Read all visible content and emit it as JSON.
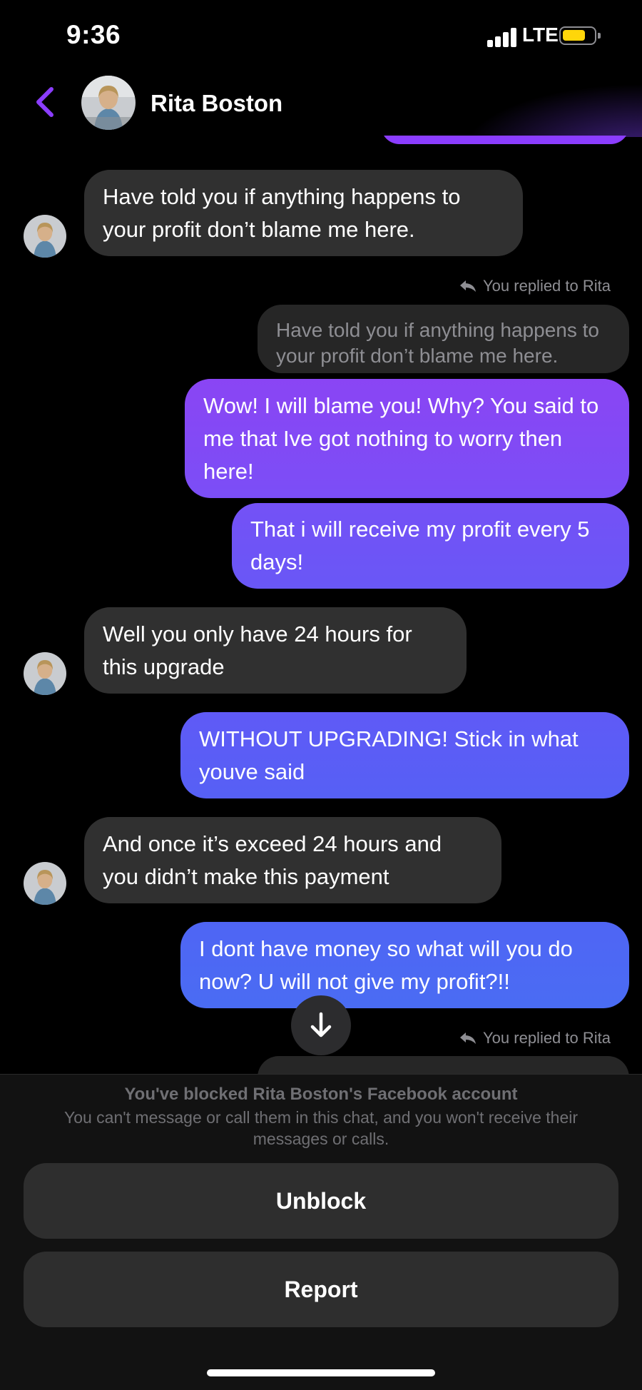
{
  "status_bar": {
    "time": "9:36",
    "network": "LTE",
    "battery_color": "#ffd60a"
  },
  "header": {
    "contact_name": "Rita Boston",
    "back_icon": "chevron-left-icon",
    "accent_color": "#8b3dff"
  },
  "messages": [
    {
      "id": "m1",
      "from": "them",
      "text": "Have told you if anything happens to your profit don’t blame me here."
    },
    {
      "id": "r1",
      "type": "reply_label",
      "text": "You replied to Rita"
    },
    {
      "id": "q1",
      "type": "quoted",
      "text": "Have told you if anything happens to your profit don’t blame me here."
    },
    {
      "id": "m2",
      "from": "me",
      "text": "Wow! I will blame you! Why? You said to me that Ive got nothing to worry then here!"
    },
    {
      "id": "m3",
      "from": "me",
      "text": "That i will receive my profit every 5 days!"
    },
    {
      "id": "m4",
      "from": "them",
      "text": "Well you only have 24 hours for this upgrade"
    },
    {
      "id": "m5",
      "from": "me",
      "text": "WITHOUT UPGRADING! Stick in what youve said"
    },
    {
      "id": "m6",
      "from": "them",
      "text": "And once it’s exceed 24 hours and you didn’t make this payment"
    },
    {
      "id": "m7",
      "from": "me",
      "text": "I dont have money so what will you do now? U will not give my profit?!!"
    },
    {
      "id": "r2",
      "type": "reply_label",
      "text": "You replied to Rita"
    }
  ],
  "blocked": {
    "title": "You've blocked Rita Boston's Facebook account",
    "description": "You can't message or call them in this chat, and you won't receive their messages or calls.",
    "unblock_label": "Unblock",
    "report_label": "Report"
  }
}
